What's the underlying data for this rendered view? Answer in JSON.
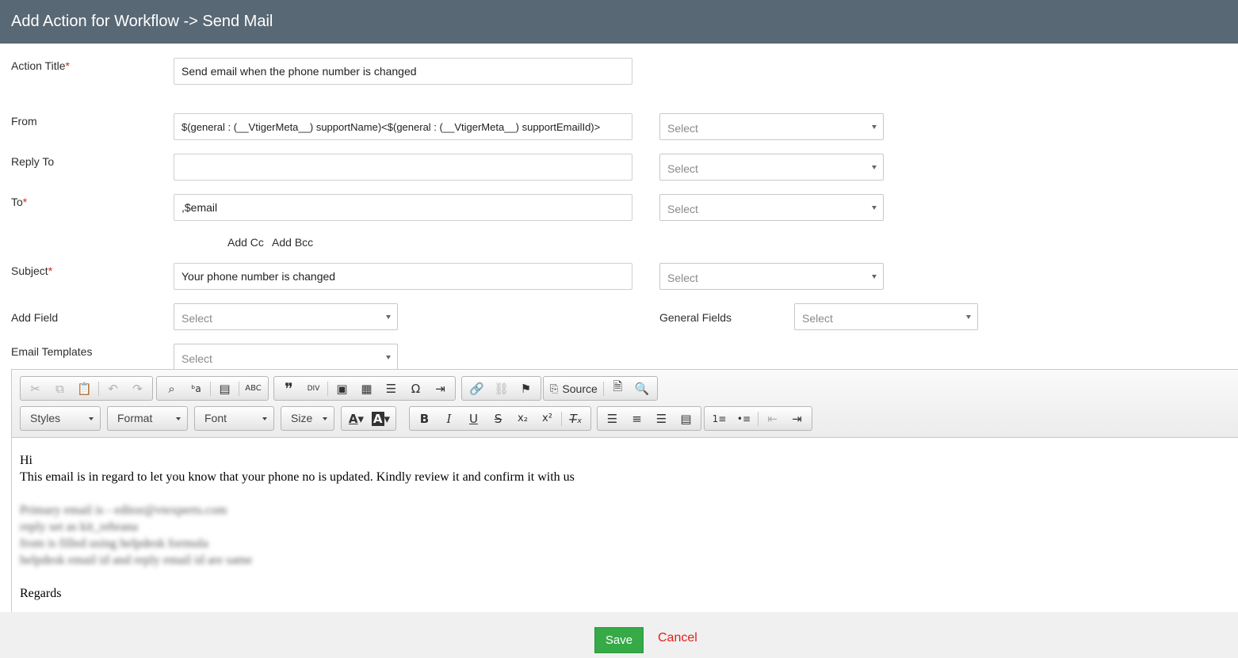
{
  "header": {
    "title": "Add Action for Workflow -> Send Mail"
  },
  "form": {
    "action_title": {
      "label": "Action Title",
      "required": "*",
      "value": "Send email when the phone number is changed"
    },
    "from": {
      "label": "From",
      "value": "$(general : (__VtigerMeta__) supportName)<$(general : (__VtigerMeta__) supportEmailId)>",
      "select": "Select"
    },
    "reply_to": {
      "label": "Reply To",
      "value": "",
      "select": "Select"
    },
    "to": {
      "label": "To",
      "required": "*",
      "value": ",$email",
      "select": "Select"
    },
    "add_cc": "Add Cc",
    "add_bcc": "Add Bcc",
    "subject": {
      "label": "Subject",
      "required": "*",
      "value": "Your phone number is changed",
      "select": "Select"
    },
    "add_field": {
      "label": "Add Field",
      "select": "Select"
    },
    "general_fields": {
      "label": "General Fields",
      "select": "Select"
    },
    "email_templates": {
      "label": "Email Templates",
      "select": "Select"
    }
  },
  "editor": {
    "combos": {
      "styles": "Styles",
      "format": "Format",
      "font": "Font",
      "size": "Size"
    },
    "source_label": "Source",
    "body": {
      "line1": "Hi",
      "line2": "This email is in regard to let you know that your phone no is updated. Kindly review it and confirm it with us",
      "blurred": [
        "Primary email is - editor@vtexperts.com",
        "reply set as kit_rebrana",
        "from is filled using helpdesk formula",
        "helpdesk email id and reply email id are same"
      ],
      "regards": "Regards"
    }
  },
  "footer": {
    "save": "Save",
    "cancel": "Cancel"
  },
  "colors": {
    "header_bg": "#596875",
    "required": "#e0201b",
    "save_bg": "#35aa47",
    "cancel": "#e0201b"
  }
}
